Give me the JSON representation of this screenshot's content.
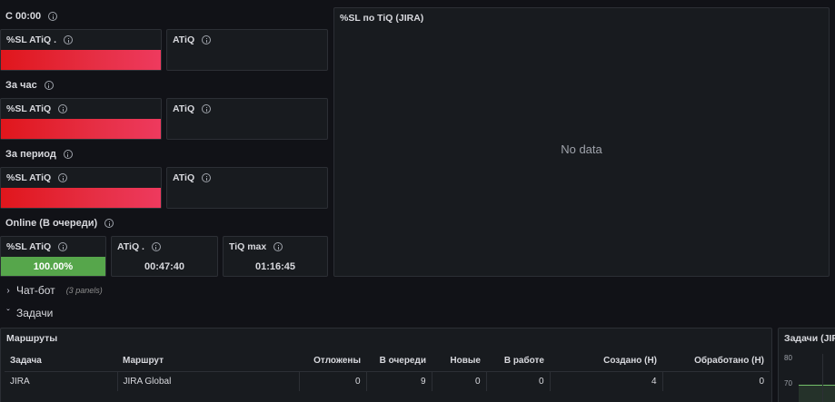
{
  "rows": {
    "since_midnight": "С 00:00",
    "per_hour": "За час",
    "per_period": "За период",
    "online": "Online (В очереди)"
  },
  "stats": {
    "sl_atiq_dot": "%SL ATiQ .",
    "sl_atiq": "%SL ATiQ",
    "atiq": "ATiQ",
    "atiq_dot": "ATiQ .",
    "tiq_max": "TiQ max",
    "online_sl_value": "100.00%",
    "online_atiq_value": "00:47:40",
    "online_tiq_max_value": "01:16:45",
    "online_sl_fraction": 1.0
  },
  "right_panel": {
    "title": "%SL по TiQ (JIRA)",
    "no_data": "No data"
  },
  "sections": {
    "chatbot": {
      "label": "Чат-бот",
      "hint": "(3 panels)"
    },
    "tasks": {
      "label": "Задачи"
    }
  },
  "routes_table": {
    "title": "Маршруты",
    "columns": [
      "Задача",
      "Маршрут",
      "Отложены",
      "В очереди",
      "Новые",
      "В работе",
      "Создано (Н)",
      "Обработано (Н)"
    ],
    "rows": [
      [
        "JIRA",
        "JIRA Global",
        "0",
        "9",
        "0",
        "0",
        "4",
        "0"
      ]
    ]
  },
  "tasks_chart": {
    "title": "Задачи (JIRA",
    "y_tick": "70",
    "y_tick_80": "80"
  },
  "colors": {
    "red_bar": "#e62f45",
    "green_bar": "#56a64b",
    "panel_bg": "#181b1f",
    "page_bg": "#111217"
  }
}
